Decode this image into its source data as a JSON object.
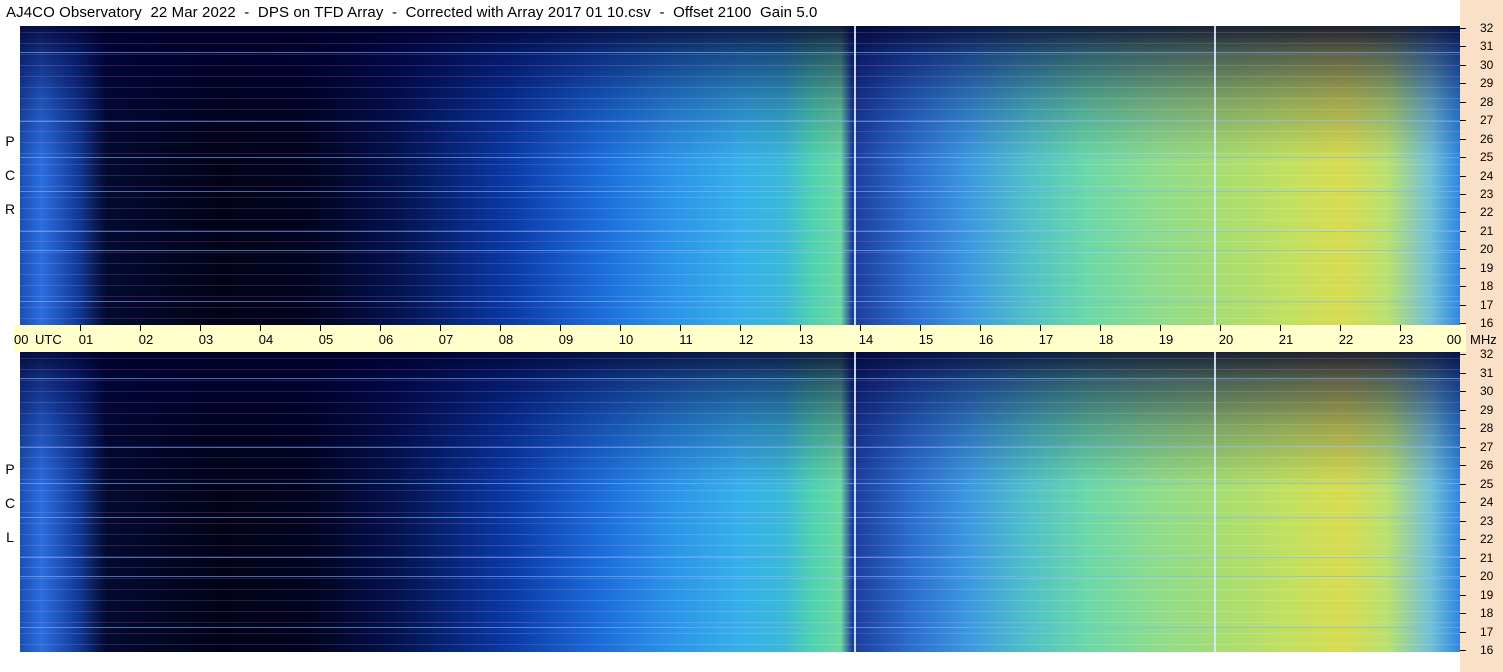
{
  "title": "AJ4CO Observatory  22 Mar 2022  -  DPS on TFD Array  -  Corrected with Array 2017 01 10.csv  -  Offset 2100  Gain 5.0",
  "panels": {
    "top": {
      "label": [
        "R",
        "C",
        "P"
      ]
    },
    "bottom": {
      "label": [
        "L",
        "C",
        "P"
      ]
    }
  },
  "time_axis": {
    "first": "00",
    "utc": "UTC",
    "hours": [
      "01",
      "02",
      "03",
      "04",
      "05",
      "06",
      "07",
      "08",
      "09",
      "10",
      "11",
      "12",
      "13",
      "14",
      "15",
      "16",
      "17",
      "18",
      "19",
      "20",
      "21",
      "22",
      "23"
    ],
    "last": "00",
    "unit": "MHz"
  },
  "freq_axis": {
    "ticks": [
      "32",
      "31",
      "30",
      "29",
      "28",
      "27",
      "26",
      "25",
      "24",
      "23",
      "22",
      "21",
      "20",
      "19",
      "18",
      "17",
      "16"
    ]
  },
  "colors": {
    "axis_background": "#ffffcc",
    "right_margin": "#fbe0c8"
  }
}
